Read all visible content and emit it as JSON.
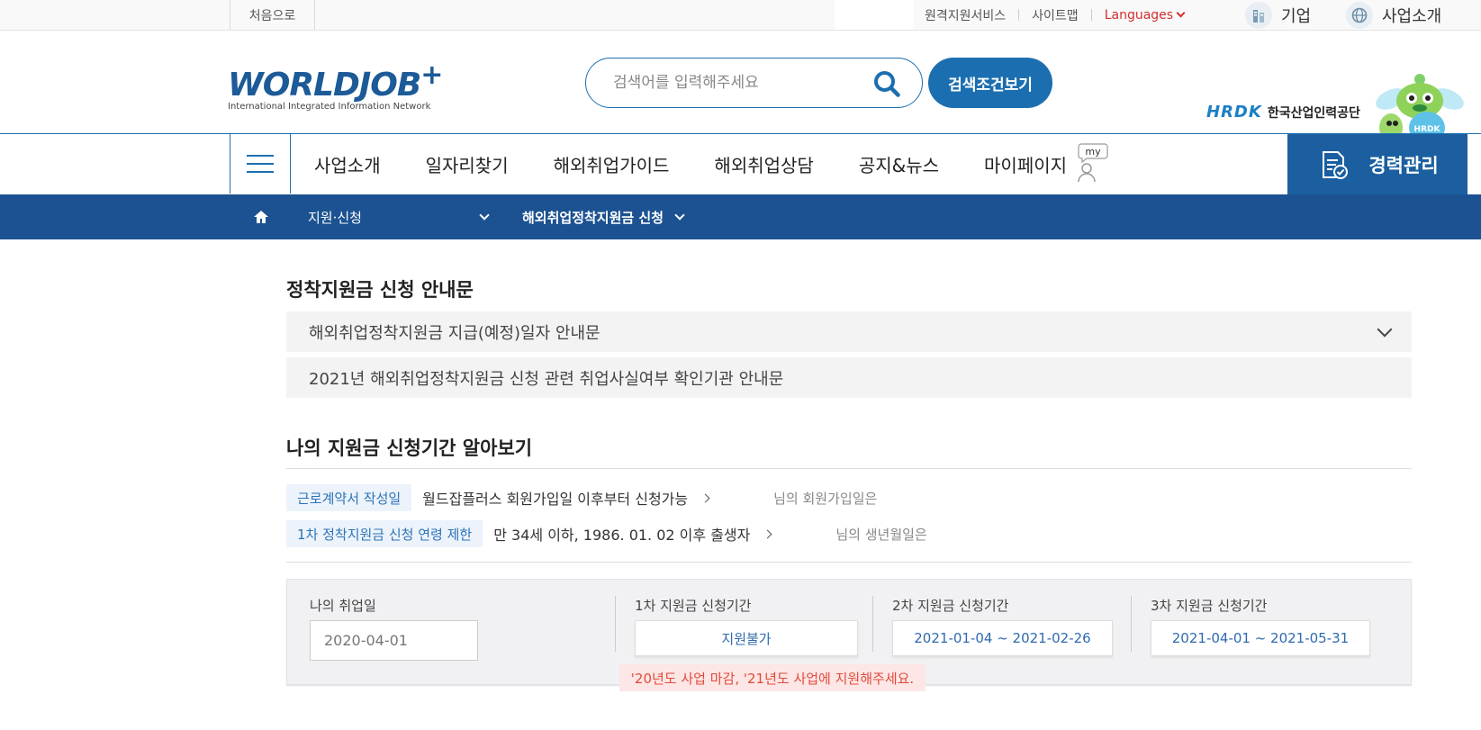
{
  "topbar": {
    "home_label": "처음으로",
    "links": [
      "원격지원서비스",
      "사이트맵"
    ],
    "languages_label": "Languages",
    "company_label": "기업",
    "intro_label": "사업소개"
  },
  "header": {
    "logo_text": "WORLDJOB",
    "logo_plus": "+",
    "logo_sub": "International Integrated Information Network",
    "search_placeholder": "검색어를 입력해주세요",
    "detail_search_label": "검색조건보기",
    "org_mark": "HRDK",
    "org_name": "한국산업인력공단",
    "mascot_text": "HRDK"
  },
  "nav": {
    "items": [
      "사업소개",
      "일자리찾기",
      "해외취업가이드",
      "해외취업상담",
      "공지&뉴스",
      "마이페이지"
    ],
    "my_badge": "my",
    "career_label": "경력관리"
  },
  "breadcrumb": {
    "level1": "지원·신청",
    "level2": "해외취업정착지원금 신청"
  },
  "guide": {
    "title": "정착지원금 신청 안내문",
    "notices": [
      "해외취업정착지원금 지급(예정)일자 안내문",
      "2021년 해외취업정착지원금 신청 관련 취업사실여부 확인기관 안내문"
    ]
  },
  "period": {
    "title": "나의 지원금 신청기간 알아보기",
    "rows": [
      {
        "tag": "근로계약서 작성일",
        "text": "월드잡플러스 회원가입일 이후부터 신청가능",
        "note": "님의 회원가입일은"
      },
      {
        "tag": "1차 정착지원금 신청 연령 제한",
        "text": "만 34세 이하, 1986. 01. 02 이후 출생자",
        "note": "님의 생년월일은"
      }
    ],
    "employment_label": "나의 취업일",
    "employment_value": "2020-04-01",
    "first_label": "1차 지원금 신청기간",
    "first_value": "지원불가",
    "second_label": "2차 지원금 신청기간",
    "second_value": "2021-01-04 ~ 2021-02-26",
    "third_label": "3차 지원금 신청기간",
    "third_value": "2021-04-01 ~ 2021-05-31",
    "warning": "'20년도 사업 마감, '21년도 사업에 지원해주세요."
  },
  "colors": {
    "brand_blue": "#1b6fb0",
    "breadcrumb_bg": "#1c5291",
    "warning_text": "#e24b3b"
  }
}
